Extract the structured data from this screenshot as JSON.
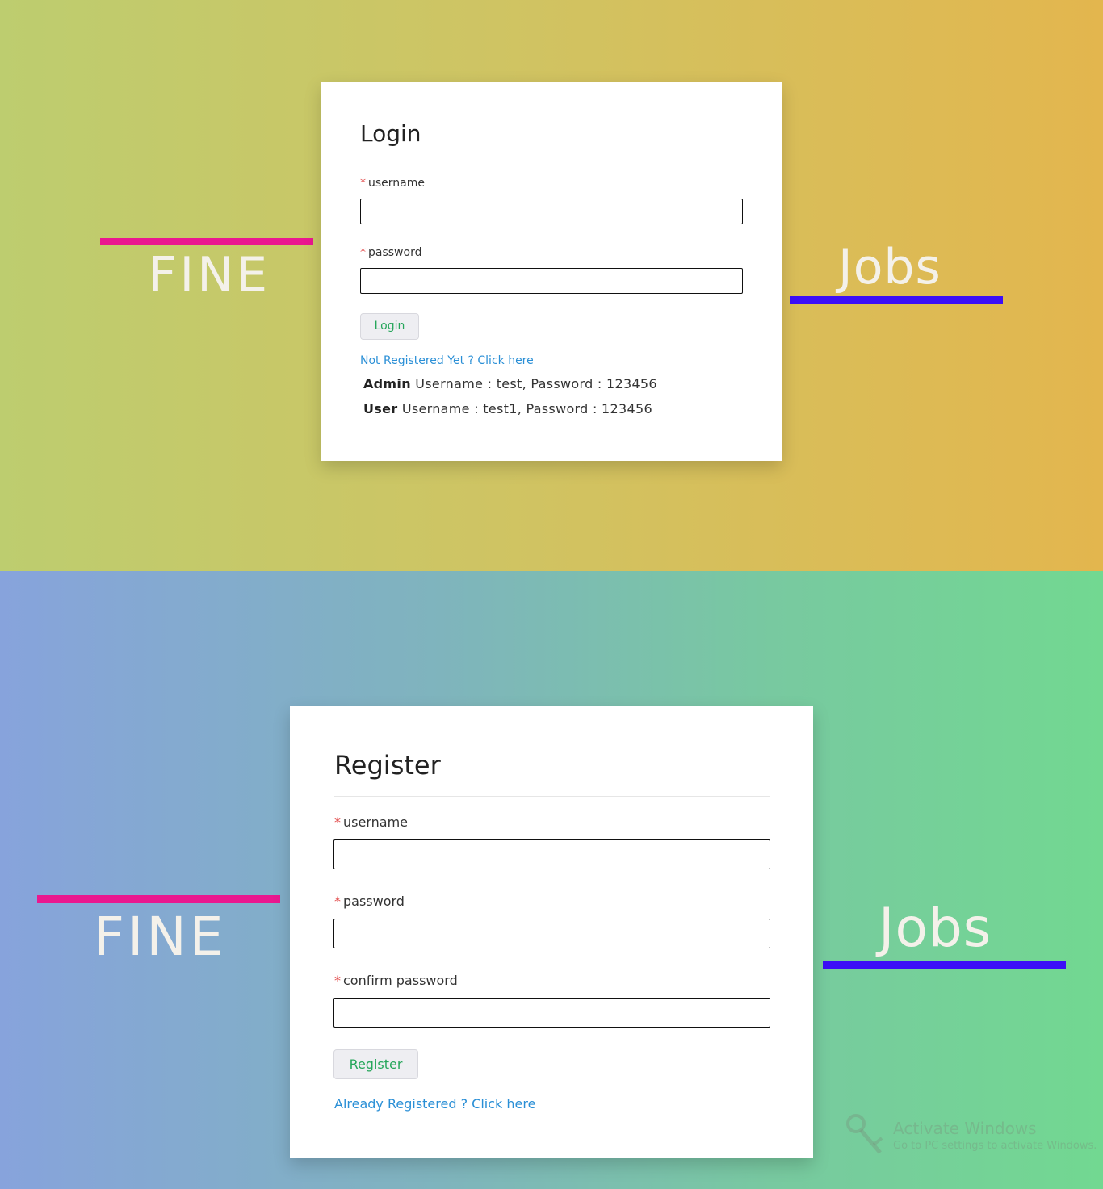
{
  "login_view": {
    "brand_left": "FINE",
    "brand_right": "Jobs",
    "card": {
      "title": "Login",
      "username_label": "username",
      "password_label": "password",
      "required_mark": "*",
      "submit_label": "Login",
      "register_link": "Not Registered Yet ? Click here",
      "admin_role": "Admin",
      "admin_creds": "Username : test, Password : 123456",
      "user_role": "User",
      "user_creds": "Username : test1, Password : 123456"
    },
    "colors": {
      "left_bar": "#ea178f",
      "right_bar": "#3c0ff7"
    }
  },
  "register_view": {
    "brand_left": "FINE",
    "brand_right": "Jobs",
    "card": {
      "title": "Register",
      "username_label": "username",
      "password_label": "password",
      "confirm_label": "confirm password",
      "required_mark": "*",
      "submit_label": "Register",
      "login_link": "Already Registered ? Click here"
    },
    "watermark": {
      "icon": "key-icon",
      "line1": "Activate Windows",
      "line2": "Go to PC settings to activate Windows."
    }
  }
}
